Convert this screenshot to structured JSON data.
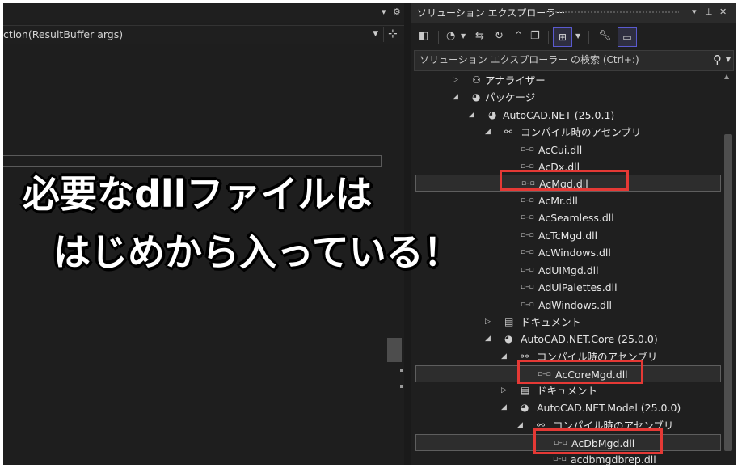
{
  "editor": {
    "nav_text": "ction(ResultBuffer args)",
    "icons": {
      "title_dropdown": "chevron-down-icon",
      "title_settings": "gear-icon",
      "nav_dropdown": "chevron-down-icon",
      "nav_split": "split-view-icon"
    }
  },
  "solution_explorer": {
    "title": "ソリューション エクスプローラー",
    "search_placeholder": "ソリューション エクスプローラー の検索 (Ctrl+:)",
    "tree": [
      {
        "label": "アナライザー",
        "icon": "analyzer-icon",
        "toggle": "collapsed"
      },
      {
        "label": "パッケージ",
        "icon": "package-icon",
        "toggle": "expanded"
      },
      {
        "label": "AutoCAD.NET (25.0.1)",
        "icon": "package-icon",
        "toggle": "expanded"
      },
      {
        "label": "コンパイル時のアセンブリ",
        "icon": "assembly-group-icon",
        "toggle": "expanded"
      },
      {
        "label": "AcCui.dll",
        "icon": "assembly-icon"
      },
      {
        "label": "AcDx.dll",
        "icon": "assembly-icon"
      },
      {
        "label": "AcMgd.dll",
        "icon": "assembly-icon",
        "selected": true,
        "highlighted": true
      },
      {
        "label": "AcMr.dll",
        "icon": "assembly-icon"
      },
      {
        "label": "AcSeamless.dll",
        "icon": "assembly-icon"
      },
      {
        "label": "AcTcMgd.dll",
        "icon": "assembly-icon"
      },
      {
        "label": "AcWindows.dll",
        "icon": "assembly-icon"
      },
      {
        "label": "AdUIMgd.dll",
        "icon": "assembly-icon"
      },
      {
        "label": "AdUiPalettes.dll",
        "icon": "assembly-icon"
      },
      {
        "label": "AdWindows.dll",
        "icon": "assembly-icon"
      },
      {
        "label": "ドキュメント",
        "icon": "document-folder-icon",
        "toggle": "collapsed"
      },
      {
        "label": "AutoCAD.NET.Core (25.0.0)",
        "icon": "package-icon",
        "toggle": "expanded"
      },
      {
        "label": "コンパイル時のアセンブリ",
        "icon": "assembly-group-icon",
        "toggle": "expanded"
      },
      {
        "label": "AcCoreMgd.dll",
        "icon": "assembly-icon",
        "selected": true,
        "highlighted": true
      },
      {
        "label": "ドキュメント",
        "icon": "document-folder-icon",
        "toggle": "collapsed"
      },
      {
        "label": "AutoCAD.NET.Model (25.0.0)",
        "icon": "package-icon",
        "toggle": "expanded"
      },
      {
        "label": "コンパイル時のアセンブリ",
        "icon": "assembly-group-icon",
        "toggle": "expanded"
      },
      {
        "label": "AcDbMgd.dll",
        "icon": "assembly-icon",
        "selected": true,
        "highlighted": true
      },
      {
        "label": "acdbmgdbrep.dll",
        "icon": "assembly-icon"
      }
    ],
    "toolbar_icons": [
      "switch-views-icon",
      "history-icon",
      "chevron-down-icon",
      "sync-icon",
      "refresh-icon",
      "collapse-all-icon",
      "show-all-files-icon",
      "toggle-view-icon",
      "chevron-down-icon",
      "properties-wrench-icon",
      "preview-icon"
    ]
  },
  "overlay": {
    "line1": "必要なdllファイルは",
    "line2": "はじめから入っている！"
  },
  "colors": {
    "background": "#1f1f1f",
    "highlight": "#e53935",
    "selection": "#2d2d2d",
    "text": "#e6e6e6"
  }
}
